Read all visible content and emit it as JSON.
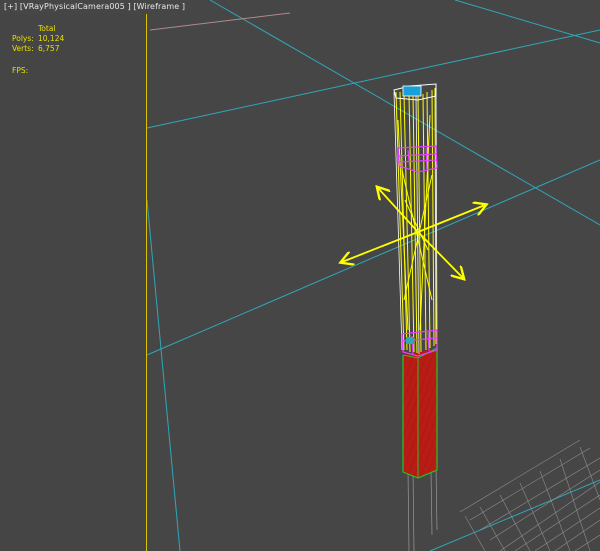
{
  "viewport": {
    "menu_label": "[+]",
    "camera_label": "[VRayPhysicalCamera005 ]",
    "shading_label": "[Wireframe ]"
  },
  "stats": {
    "header": "Total",
    "polys_label": "Polys:",
    "polys_value": "10,124",
    "verts_label": "Verts:",
    "verts_value": "6,757",
    "fps_label": "FPS:"
  },
  "colors": {
    "viewport_bg": "#444444",
    "grid_line": "#2fa7b8",
    "selection_yellow": "#ffff00",
    "wire_magenta": "#e040ff",
    "red_block": "#b81c14",
    "green_edge": "#22c622"
  },
  "gizmo": {
    "type": "move-transform-gizmo"
  }
}
